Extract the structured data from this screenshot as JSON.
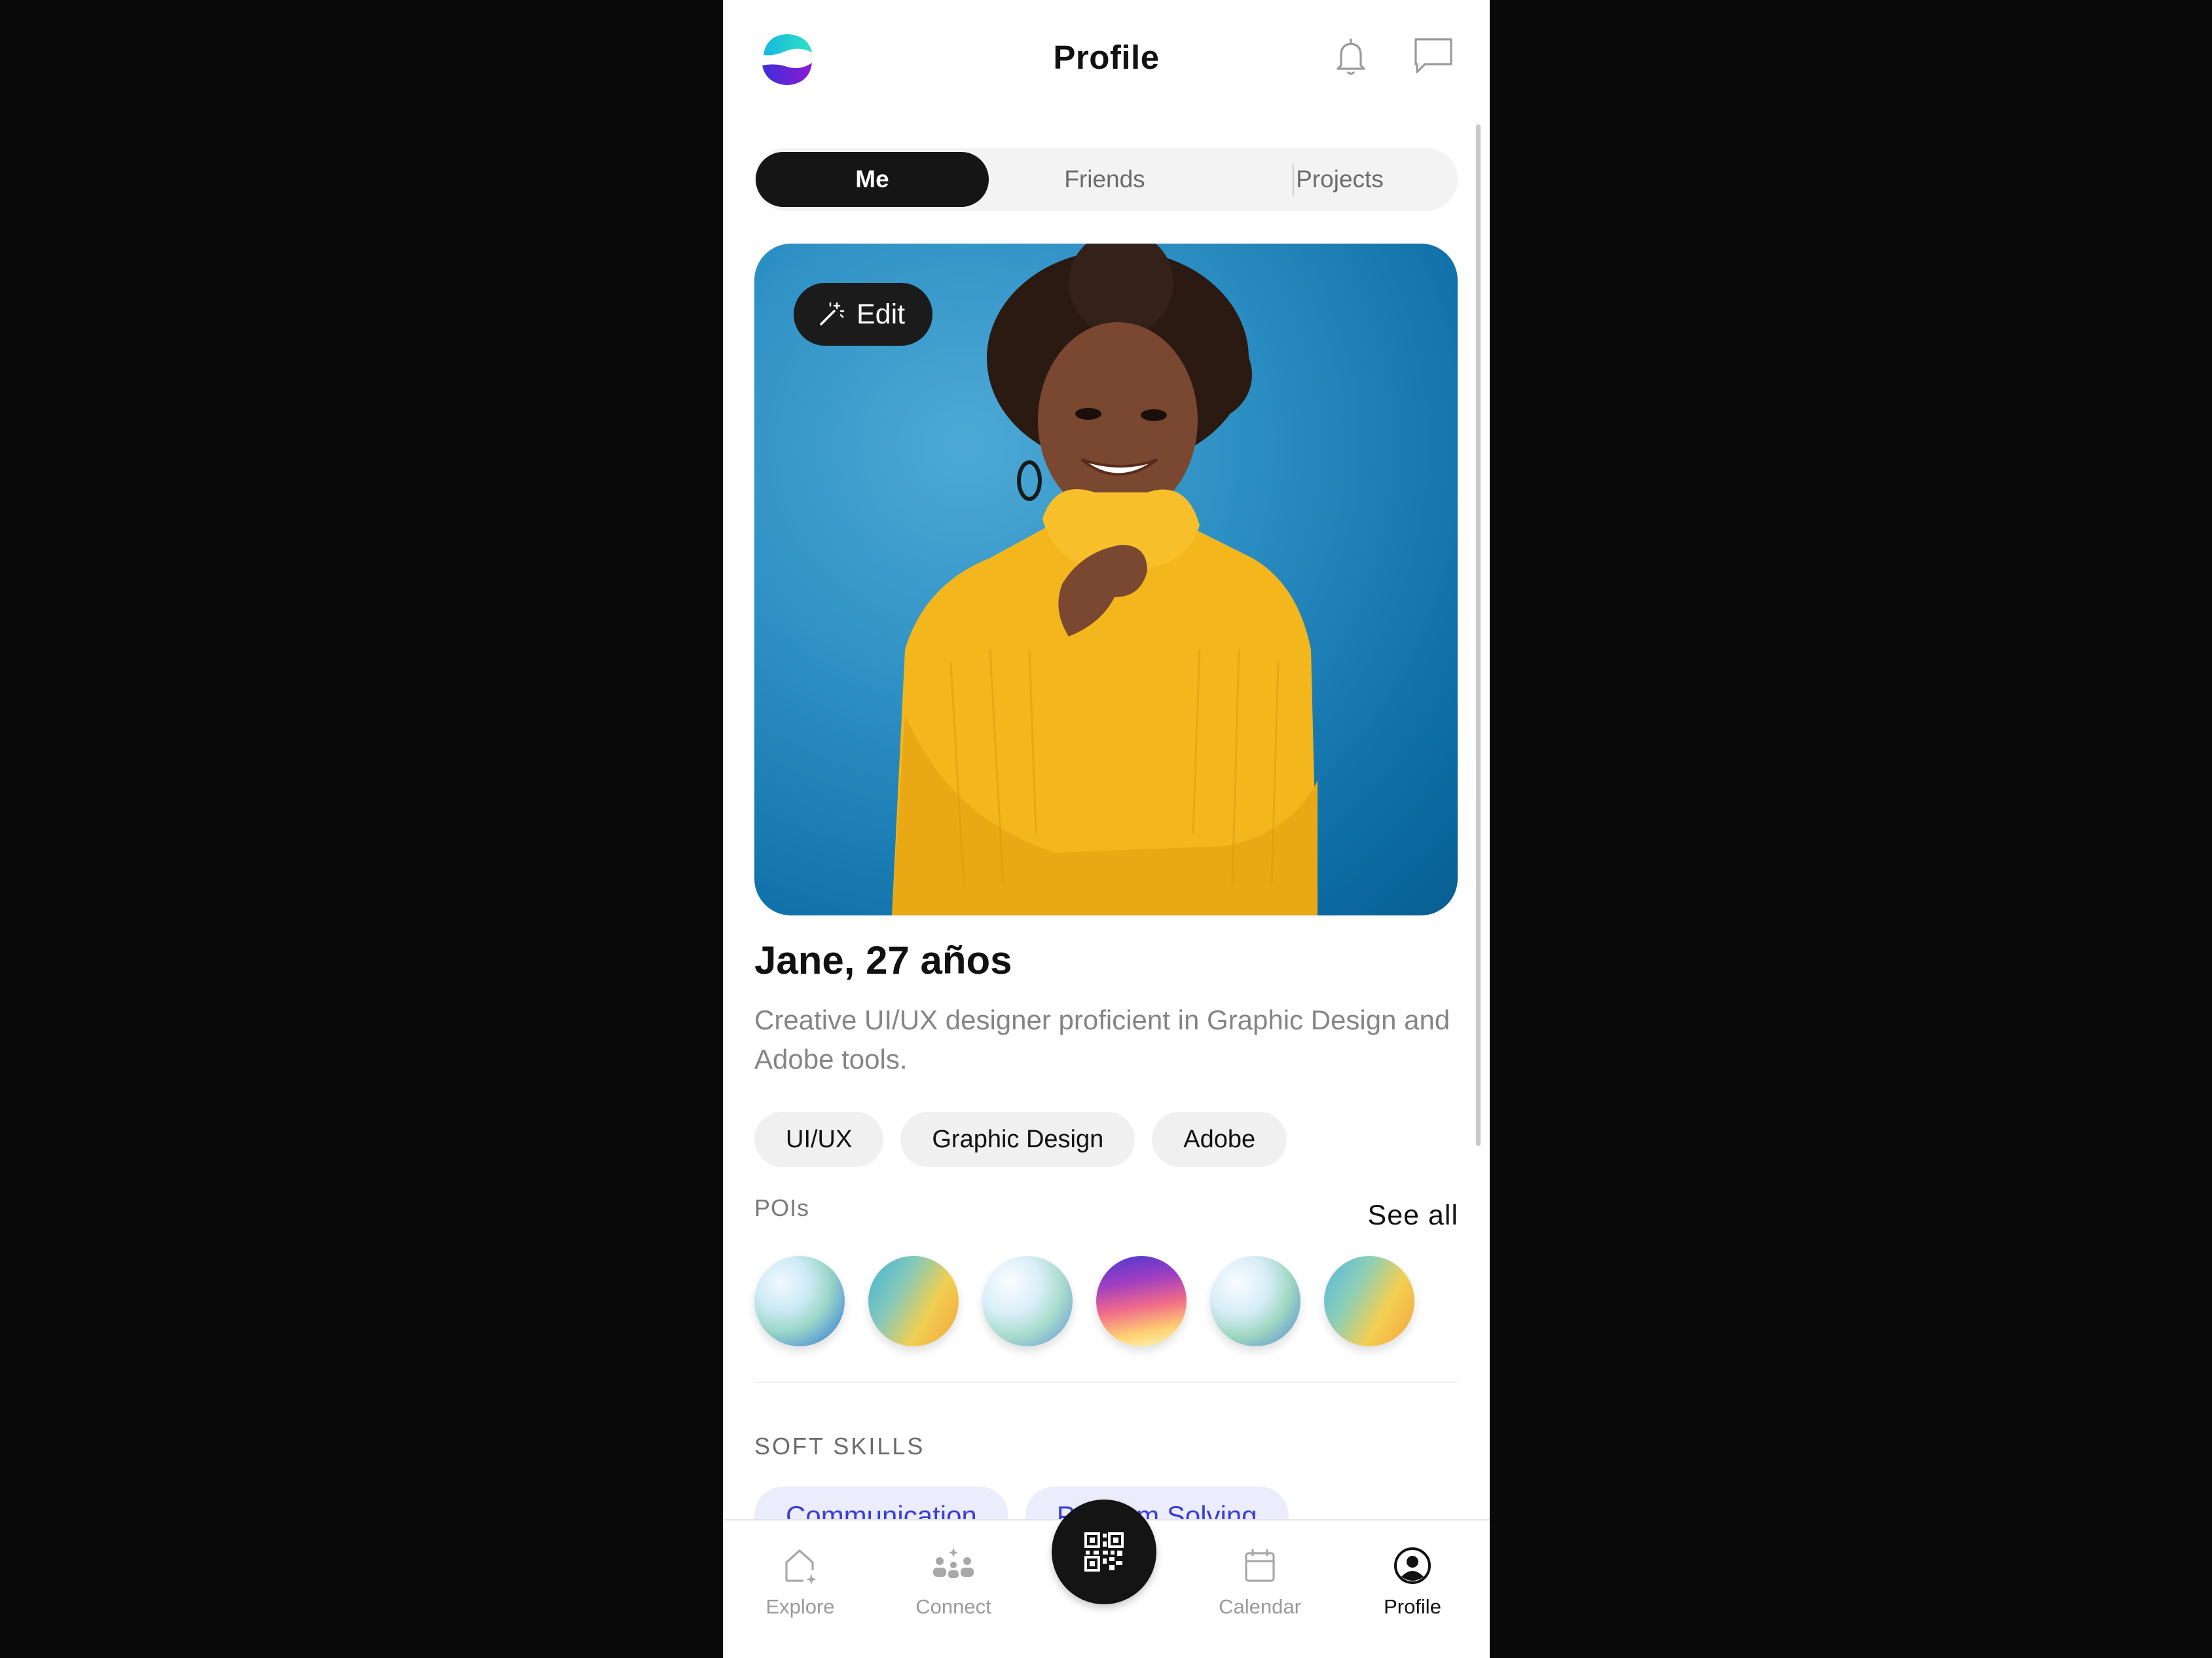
{
  "header": {
    "title": "Profile",
    "logo_icon": "brand-logo",
    "notification_icon": "bell-icon",
    "messages_icon": "chat-icon"
  },
  "tabs": [
    {
      "label": "Me",
      "active": true
    },
    {
      "label": "Friends",
      "active": false
    },
    {
      "label": "Projects",
      "active": false
    }
  ],
  "profile": {
    "edit_label": "Edit",
    "name": "Jane, 27 años",
    "bio": "Creative UI/UX designer proficient in Graphic Design and Adobe tools.",
    "skills": [
      "UI/UX",
      "Graphic Design",
      "Adobe"
    ]
  },
  "pois": {
    "title": "POIs",
    "see_all": "See all",
    "count": 6
  },
  "soft_skills": {
    "title": "SOFT SKILLS",
    "items": [
      "Communication",
      "Problem Solving"
    ]
  },
  "bottom_nav": {
    "items": [
      {
        "label": "Explore",
        "icon": "explore-icon",
        "active": false
      },
      {
        "label": "Connect",
        "icon": "connect-icon",
        "active": false
      },
      {
        "label": "Calendar",
        "icon": "calendar-icon",
        "active": false
      },
      {
        "label": "Profile",
        "icon": "profile-icon",
        "active": true
      }
    ],
    "center_icon": "qr-code-icon"
  },
  "colors": {
    "accent_dark": "#151515",
    "soft_chip_bg": "#ebedfd",
    "soft_chip_text": "#3b3fd8",
    "photo_bg": "#1f86bf",
    "sweater": "#f4b91c"
  }
}
